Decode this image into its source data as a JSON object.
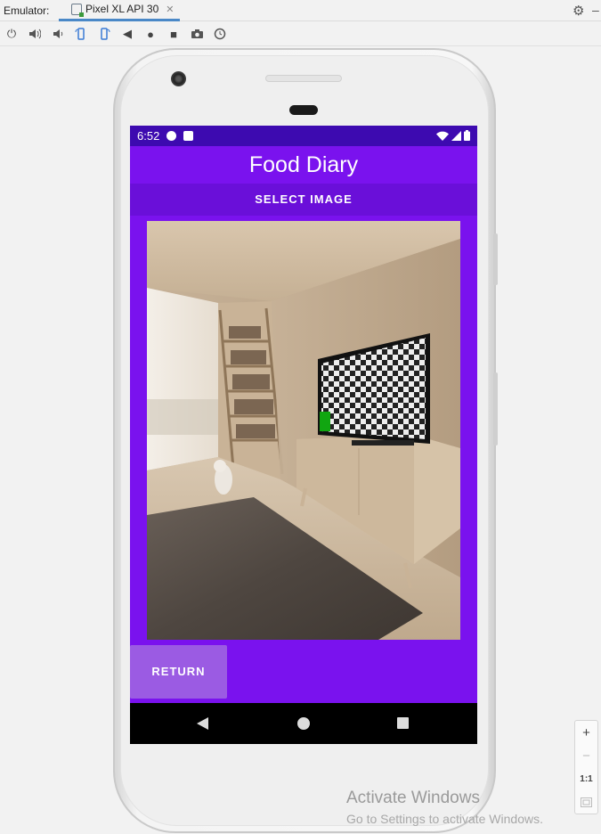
{
  "ide": {
    "tool_label": "Emulator:",
    "device_tab": "Pixel XL API 30",
    "close_glyph": "✕",
    "settings_icon": "gear-icon",
    "toolbar_icons": [
      "power-icon",
      "volume-up-icon",
      "volume-down-icon",
      "rotate-left-icon",
      "rotate-right-icon",
      "back-icon",
      "home-icon",
      "overview-icon",
      "screenshot-icon",
      "snapshot-icon"
    ]
  },
  "device": {
    "status": {
      "time": "6:52"
    },
    "app": {
      "title": "Food Diary",
      "select_button": "SELECT IMAGE",
      "return_button": "RETURN",
      "accent": "#7a12ee",
      "status_bar_color": "#3d0ab0"
    }
  },
  "zoom_controls": {
    "zoom_in": "+",
    "zoom_out": "−",
    "actual_size": "1:1"
  },
  "watermark": {
    "line1": "Activate Windows",
    "line2": "Go to Settings to activate Windows."
  }
}
